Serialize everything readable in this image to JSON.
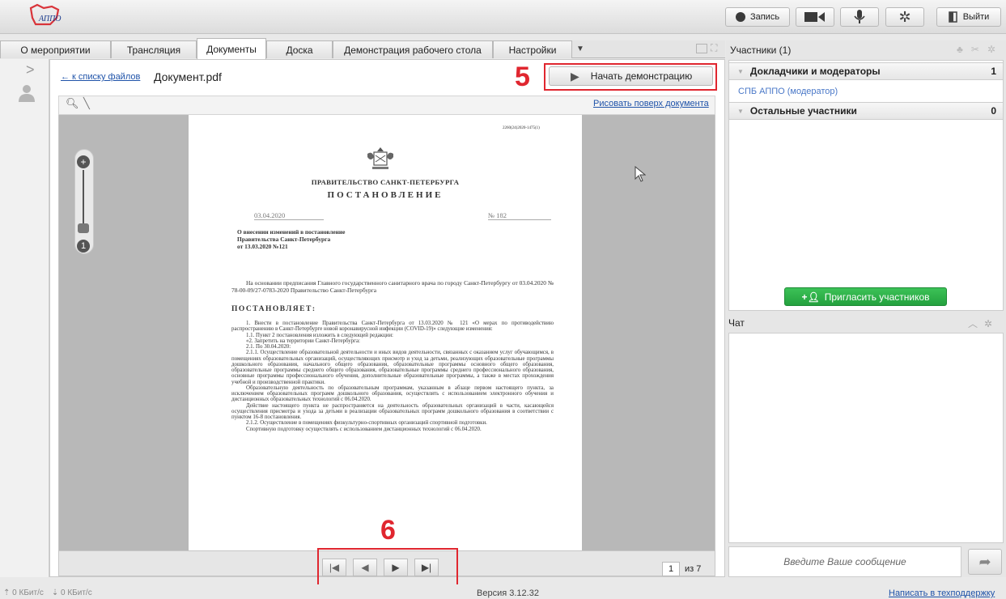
{
  "header": {
    "record_label": "Запись",
    "exit_label": "Выйти"
  },
  "tabs": [
    "О мероприятии",
    "Трансляция",
    "Документы",
    "Доска",
    "Демонстрация рабочего стола",
    "Настройки"
  ],
  "active_tab": "Документы",
  "document": {
    "back_link": "← к списку файлов",
    "filename": "Документ.pdf",
    "start_demo_label": "Начать демонстрацию",
    "draw_link": "Рисовать поверх документа",
    "annotation_start": "5",
    "annotation_nav": "6",
    "current_page": "1",
    "page_total_label": "из 7"
  },
  "pdf": {
    "doc_code": "2260(24)2020-1475(1)",
    "government": "ПРАВИТЕЛЬСТВО САНКТ-ПЕТЕРБУРГА",
    "decree": "ПОСТАНОВЛЕНИЕ",
    "date": "03.04.2020",
    "number": "№ 182",
    "subject_lines": [
      "О внесении изменений в постановление",
      "Правительства Санкт-Петербурга",
      "от 13.03.2020 №121"
    ],
    "intro": "На основании предписания Главного государственного санитарного врача по городу Санкт-Петербургу от 03.04.2020 № 78-00-09/27-0783-2020 Правительство Санкт-Петербурга",
    "resolves": "ПОСТАНОВЛЯЕТ:",
    "body": [
      "1. Внести в постановление Правительства Санкт-Петербурга от 13.03.2020 № 121 «О мерах по противодействию распространению в Санкт-Петербурге новой коронавирусной инфекции (COVID-19)» следующие изменения:",
      "1.1. Пункт 2 постановления изложить в следующей редакции:",
      "«2. Запретить на территории Санкт-Петербурга:",
      "2.1. По 30.04.2020:",
      "2.1.1. Осуществление образовательной деятельности и иных видов деятельности, связанных с оказанием услуг обучающимся, в помещениях образовательных организаций, осуществляющих присмотр и уход за детьми, реализующих образовательные программы дошкольного образования, начального общего образования, образовательные программы основного общего образования, образовательные программы среднего общего образования, образовательные программы среднего профессионального образования, основные программы профессионального обучения, дополнительные образовательные программы, а также в местах прохождения учебной и производственной практики.",
      "Образовательную деятельность по образовательным программам, указанным в абзаце первом настоящего пункта, за исключением образовательных программ дошкольного образования, осуществлять с использованием электронного обучения и дистанционных образовательных технологий с 06.04.2020.",
      "Действие настоящего пункта не распространяется на деятельность образовательных организаций в части, касающейся осуществления присмотра и ухода за детьми в реализации образовательных программ дошкольного образования в соответствии с пунктом 16-8 постановления.",
      "2.1.2. Осуществление в помещениях физкультурно-спортивных организаций спортивной подготовки.",
      "Спортивную подготовку осуществлять с использованием дистанционных технологий с 06.04.2020."
    ]
  },
  "participants": {
    "header": "Участники (1)",
    "group1_label": "Докладчики и модераторы",
    "group1_count": "1",
    "member": "СПБ АППО (модератор)",
    "group2_label": "Остальные участники",
    "group2_count": "0",
    "invite_label": "Пригласить участников"
  },
  "chat": {
    "header": "Чат",
    "placeholder": "Введите Ваше сообщение"
  },
  "status": {
    "upload": "0 КБит/с",
    "download": "0 КБит/с",
    "version": "Версия 3.12.32",
    "support_link": "Написать в техподдержку"
  },
  "colors": {
    "accent_red": "#e0262f",
    "invite_green": "#2fb24a",
    "link_blue": "#1f53a9"
  }
}
